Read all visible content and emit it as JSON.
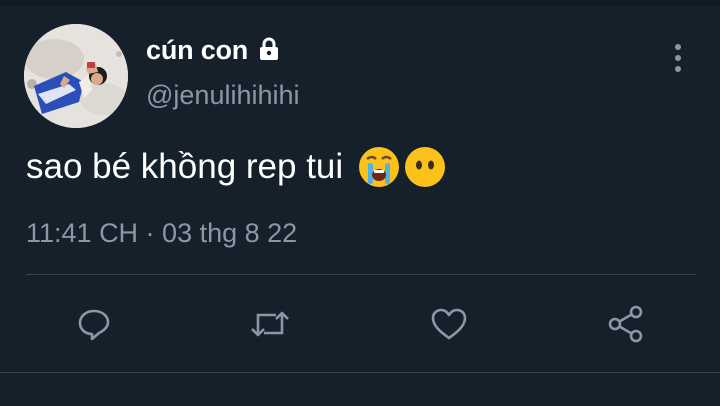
{
  "tweet": {
    "display_name": "cún con",
    "handle": "@jenulihihihi",
    "text": "sao bé khồng rep tui",
    "emojis": [
      "loudly-crying-face",
      "face-without-mouth"
    ],
    "timestamp": "11:41 CH · 03 thg 8 22",
    "protected_icon": "lock-icon"
  },
  "actions": [
    {
      "name": "reply",
      "icon": "reply-icon"
    },
    {
      "name": "retweet",
      "icon": "retweet-icon"
    },
    {
      "name": "like",
      "icon": "heart-icon"
    },
    {
      "name": "share",
      "icon": "share-icon"
    }
  ],
  "colors": {
    "background": "#15202b",
    "primary_text": "#ffffff",
    "secondary_text": "#8899a6",
    "divider": "#38444d"
  }
}
